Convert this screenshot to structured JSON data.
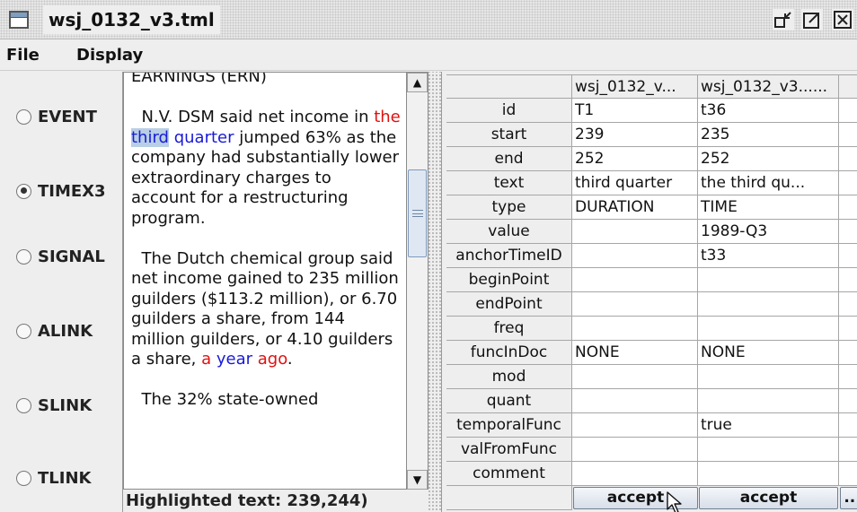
{
  "window": {
    "title": "wsj_0132_v3.tml",
    "icons": [
      "window-menu-icon",
      "minimize-icon",
      "maximize-icon",
      "close-icon"
    ]
  },
  "menu": {
    "file": "File",
    "display": "Display"
  },
  "tag_types": [
    {
      "label": "EVENT",
      "selected": false
    },
    {
      "label": "TIMEX3",
      "selected": true
    },
    {
      "label": "SIGNAL",
      "selected": false
    },
    {
      "label": "ALINK",
      "selected": false
    },
    {
      "label": "SLINK",
      "selected": false
    },
    {
      "label": "TLINK",
      "selected": false
    }
  ],
  "document": {
    "top_line": "EARNINGS (ERN)",
    "p1": {
      "a": "N.V. DSM said net income in ",
      "the": "the",
      "third": "third",
      "quarter": "quarter",
      "b": " jumped 63% as the company had substantially lower extraordinary charges to account for a restructuring program."
    },
    "p2": {
      "a": "The Dutch chemical group said net income gained to 235 million guilders ($113.2 million), or 6.70 guilders a share, from 144 million guilders, or 4.10 guilders a share, ",
      "a_word": "a",
      "year": "year",
      "ago": "ago",
      "b": "."
    },
    "p3": "The 32% state-owned"
  },
  "status": {
    "text": "Highlighted text: 239,244)"
  },
  "table": {
    "columns": [
      "wsj_0132_v...",
      "wsj_0132_v3......",
      ""
    ],
    "rows": [
      {
        "attr": "id",
        "c1": "T1",
        "c2": "t36"
      },
      {
        "attr": "start",
        "c1": "239",
        "c2": "235"
      },
      {
        "attr": "end",
        "c1": "252",
        "c2": "252"
      },
      {
        "attr": "text",
        "c1": "third quarter",
        "c2": "the third qu..."
      },
      {
        "attr": "type",
        "c1": "DURATION",
        "c2": "TIME"
      },
      {
        "attr": "value",
        "c1": "",
        "c2": "1989-Q3"
      },
      {
        "attr": "anchorTimeID",
        "c1": "",
        "c2": "t33"
      },
      {
        "attr": "beginPoint",
        "c1": "",
        "c2": ""
      },
      {
        "attr": "endPoint",
        "c1": "",
        "c2": ""
      },
      {
        "attr": "freq",
        "c1": "",
        "c2": ""
      },
      {
        "attr": "funcInDoc",
        "c1": "NONE",
        "c2": "NONE"
      },
      {
        "attr": "mod",
        "c1": "",
        "c2": ""
      },
      {
        "attr": "quant",
        "c1": "",
        "c2": ""
      },
      {
        "attr": "temporalFunc",
        "c1": "",
        "c2": "true"
      },
      {
        "attr": "valFromFunc",
        "c1": "",
        "c2": ""
      },
      {
        "attr": "comment",
        "c1": "",
        "c2": ""
      }
    ],
    "buttons": [
      "accept",
      "accept",
      "..."
    ]
  }
}
